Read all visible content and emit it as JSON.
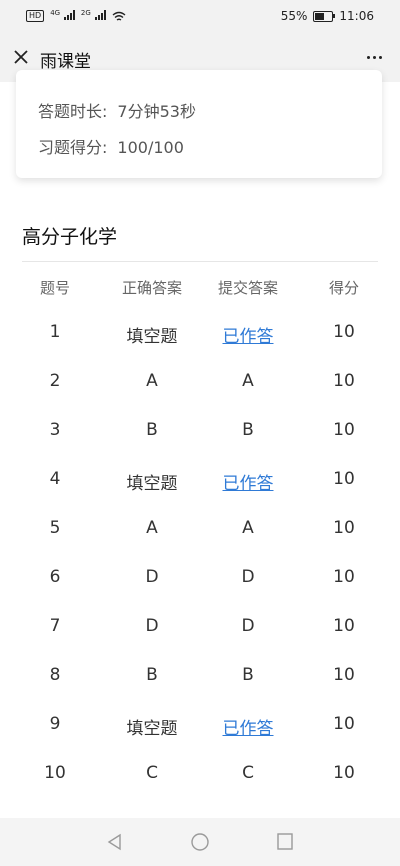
{
  "status_bar": {
    "network_left": "4G",
    "network_right": "2G",
    "battery_text": "55%",
    "battery_level": 0.55,
    "time": "11:06"
  },
  "nav": {
    "title": "雨课堂",
    "close_icon": "close-icon",
    "more_icon": "more-icon"
  },
  "summary": {
    "duration_label": "答题时长:",
    "duration_value": "7分钟53秒",
    "score_label": "习题得分:",
    "score_value": "100/100"
  },
  "course": {
    "title": "高分子化学"
  },
  "table": {
    "headers": [
      "题号",
      "正确答案",
      "提交答案",
      "得分"
    ],
    "rows": [
      {
        "no": "1",
        "correct": "填空题",
        "submitted": "已作答",
        "score": "10"
      },
      {
        "no": "2",
        "correct": "A",
        "submitted": "A",
        "score": "10"
      },
      {
        "no": "3",
        "correct": "B",
        "submitted": "B",
        "score": "10"
      },
      {
        "no": "4",
        "correct": "填空题",
        "submitted": "已作答",
        "score": "10"
      },
      {
        "no": "5",
        "correct": "A",
        "submitted": "A",
        "score": "10"
      },
      {
        "no": "6",
        "correct": "D",
        "submitted": "D",
        "score": "10"
      },
      {
        "no": "7",
        "correct": "D",
        "submitted": "D",
        "score": "10"
      },
      {
        "no": "8",
        "correct": "B",
        "submitted": "B",
        "score": "10"
      },
      {
        "no": "9",
        "correct": "填空题",
        "submitted": "已作答",
        "score": "10"
      },
      {
        "no": "10",
        "correct": "C",
        "submitted": "C",
        "score": "10"
      }
    ]
  },
  "colors": {
    "link": "#2f7ad6",
    "bar_bg": "#f2f2f2"
  },
  "system_nav": {
    "icons": [
      "back-icon",
      "home-icon",
      "recents-icon"
    ]
  }
}
